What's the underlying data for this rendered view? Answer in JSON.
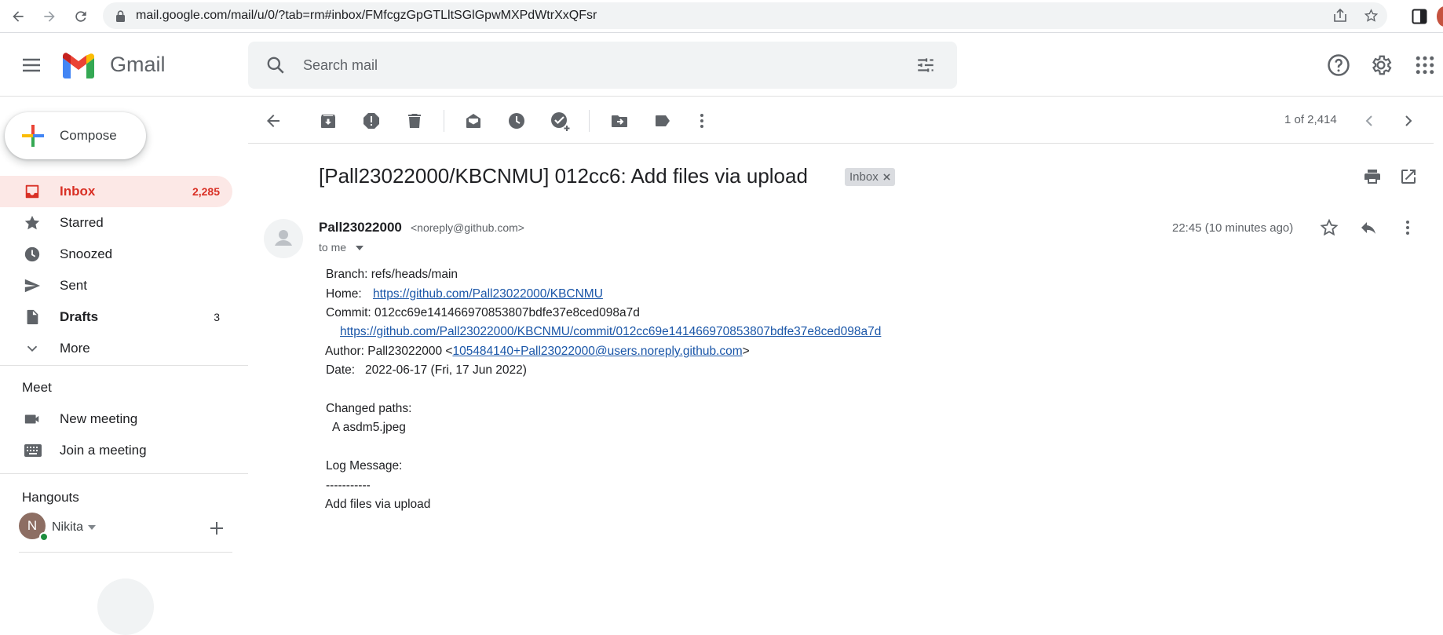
{
  "browser": {
    "url": "mail.google.com/mail/u/0/?tab=rm#inbox/FMfcgzGpGTLltSGlGpwMXPdWtrXxQFsr"
  },
  "header": {
    "app_name": "Gmail",
    "search_placeholder": "Search mail"
  },
  "sidebar": {
    "compose_label": "Compose",
    "items": [
      {
        "label": "Inbox",
        "count": "2,285"
      },
      {
        "label": "Starred",
        "count": ""
      },
      {
        "label": "Snoozed",
        "count": ""
      },
      {
        "label": "Sent",
        "count": ""
      },
      {
        "label": "Drafts",
        "count": "3"
      },
      {
        "label": "More",
        "count": ""
      }
    ],
    "meet": {
      "title": "Meet",
      "new_meeting": "New meeting",
      "join_meeting": "Join a meeting"
    },
    "hangouts": {
      "title": "Hangouts",
      "user_initial": "N",
      "user_name": "Nikita"
    }
  },
  "toolbar": {
    "page_count": "1 of 2,414"
  },
  "message": {
    "subject": "[Pall23022000/KBCNMU] 012cc6: Add files via upload",
    "label": "Inbox",
    "sender_name": "Pall23022000",
    "sender_email": "<noreply@github.com>",
    "to": "to me",
    "time": "22:45 (10 minutes ago)",
    "body": {
      "branch": "Branch: refs/heads/main",
      "home_label": "Home:",
      "home_link": "https://github.com/Pall23022000/KBCNMU",
      "commit": "Commit: 012cc69e141466970853807bdfe37e8ced098a7d",
      "commit_link": "https://github.com/Pall23022000/KBCNMU/commit/012cc69e141466970853807bdfe37e8ced098a7d",
      "author_prefix": "Author: Pall23022000 <",
      "author_email": "105484140+Pall23022000@users.noreply.github.com",
      "author_suffix": ">",
      "date": "Date:   2022-06-17 (Fri, 17 Jun 2022)",
      "changed_paths": "Changed paths:",
      "changed_file": "A asdm5.jpeg",
      "log_message": "Log Message:",
      "separator": "-----------",
      "log_text": "Add files via upload"
    }
  }
}
